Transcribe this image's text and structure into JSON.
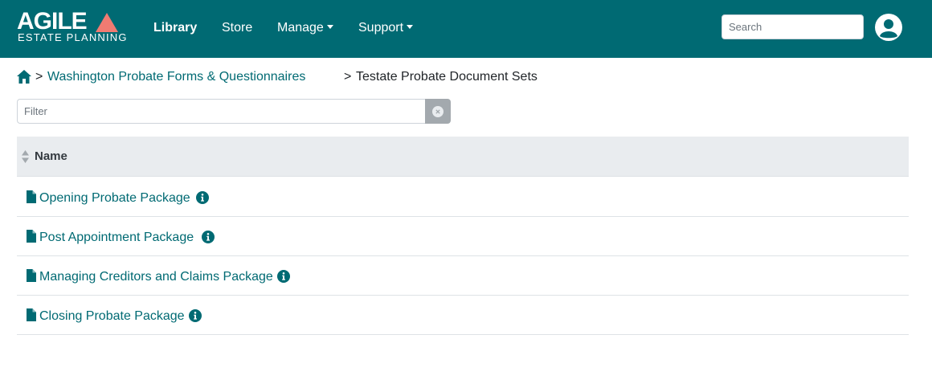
{
  "brand": {
    "logo_main": "AGILE",
    "logo_sub": "ESTATE PLANNING",
    "accent": "#f07b72",
    "primary": "#006a73"
  },
  "nav": {
    "library": "Library",
    "store": "Store",
    "manage": "Manage",
    "support": "Support"
  },
  "search": {
    "placeholder": "Search"
  },
  "breadcrumb": {
    "sep": ">",
    "parent": "Washington Probate Forms & Questionnaires",
    "current": "Testate Probate Document Sets"
  },
  "filter": {
    "placeholder": "Filter"
  },
  "table": {
    "column_name": "Name",
    "rows": [
      {
        "label": "Opening Probate Package"
      },
      {
        "label": "Post Appointment Package"
      },
      {
        "label": "Managing Creditors and Claims Package"
      },
      {
        "label": "Closing Probate Package"
      }
    ]
  }
}
